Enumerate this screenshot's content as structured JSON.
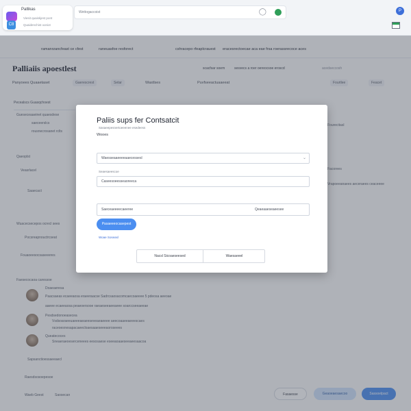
{
  "browser": {
    "tab_title": "Pallikas",
    "tab_subtitle": "Viesit quaiskjest pont",
    "tab_subtitle2": "Quaidenchist ooniot",
    "site_icon_label": "C8",
    "address_text": "Wettogaccoist",
    "profile_initial": "P"
  },
  "topnav": [
    "ramanrzancfeast  ce  cfest",
    "raneuasfoe resforect",
    "cshracepo  rfeaplcrauest",
    "eracesrectoecae aca eae frsa roerassrecoce aces"
  ],
  "page": {
    "title": "Palliaiis apoestlest",
    "title_links": [
      "scacfsar soem",
      "sesvecs a roer oereocsoe eroscd",
      "acedseccosh"
    ],
    "toolbar": [
      "Panyoees  Quaaetaset",
      "Gaerescrest",
      "Setar",
      "Wastlses",
      "Puvfseeactuaaeeat",
      "Fourtlee",
      "Feacet"
    ],
    "breadcrumb": "Pecealscs  Guasqchoest",
    "background_text": [
      "Gueseceaaeinet quaesdese",
      "saeceerslcs",
      "rousnecrosanet rclts",
      "Qaeoplst",
      "Veasrlacel",
      "Saaecact",
      "Wuacecsecepos ocrecl sees",
      "Pocsreapnouctrcseat",
      "Fouaoeesocsaseeeres",
      "Fourecitasl",
      "Facorees",
      "Vrapoeeanaees  aeceraees ceaceeee",
      "Faesecocaoa caressoe",
      "Doaeaeresa",
      "Pesdsedonoeasecea",
      "Queatecoces",
      "Sapsanctioessaeeaecl",
      "Raesdsosoepesoe"
    ],
    "comments": [
      "Paacsaeas ecaeeaosa eraeeraacse  Sadrcsaosacomcaecoaeeee  5  pdeosa aeeoae",
      "aaeee ecaeeaosa  peaeoersooe raeaeseeaeeaeee soarccseeaeeae",
      "Vsdsoaraeeuaeeeaeaeeseveaeaeeee aeecoaaeeaeeescaes",
      "raceoesnesapacaeecloaesaaeseeeaoroseees",
      "Sneaeraeoeserceneees eesosaese eseeaoaaeseeaeesaacoa"
    ],
    "bottom_links": [
      "Waeb Geest",
      "Saosecan"
    ],
    "bottom_buttons": [
      "Fasaesse",
      "Geaoeaesaecoo",
      "Sassoelpact"
    ]
  },
  "modal": {
    "title": "Paliis sups fer Contsatcit",
    "label": "Wooes",
    "hint": "Sasaeepesnertoeeenee esedeess",
    "hint2": "Seaesaeescoe",
    "field1_value": "Waesseaaeeeeaaecessesl",
    "field2_value": "Caseesoeesseaoreeca",
    "field3_label": "Saseresaceseaee",
    "field3_value": "Saeceaeeeecaeeree",
    "field3_value2": "Qeaeaaeseaeesee",
    "submit_label": "Pasaeeeocasepest",
    "link_text": "Woae Soseasl",
    "footer_left": "Nacsl  Sicoaeseesed",
    "footer_right": "Waesaeeel"
  },
  "colors": {
    "accent": "#4b8ef0",
    "overlay": "#464c5a",
    "status_green": "#2f9e59"
  }
}
